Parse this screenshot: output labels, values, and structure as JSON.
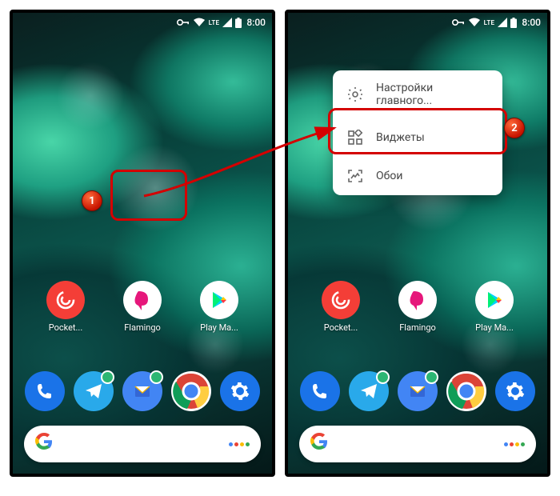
{
  "status": {
    "time": "8:00",
    "network": "LTE"
  },
  "apps_row": [
    {
      "label": "Pocket...",
      "icon": "pocket"
    },
    {
      "label": "Flamingo",
      "icon": "flamingo"
    },
    {
      "label": "Play Ма...",
      "icon": "play"
    }
  ],
  "dock": [
    {
      "icon": "phone"
    },
    {
      "icon": "telegram"
    },
    {
      "icon": "inbox"
    },
    {
      "icon": "chrome"
    },
    {
      "icon": "settings"
    }
  ],
  "context_menu": {
    "settings": "Настройки главного...",
    "widgets": "Виджеты",
    "wallpapers": "Обои"
  },
  "callouts": {
    "one": "1",
    "two": "2"
  }
}
